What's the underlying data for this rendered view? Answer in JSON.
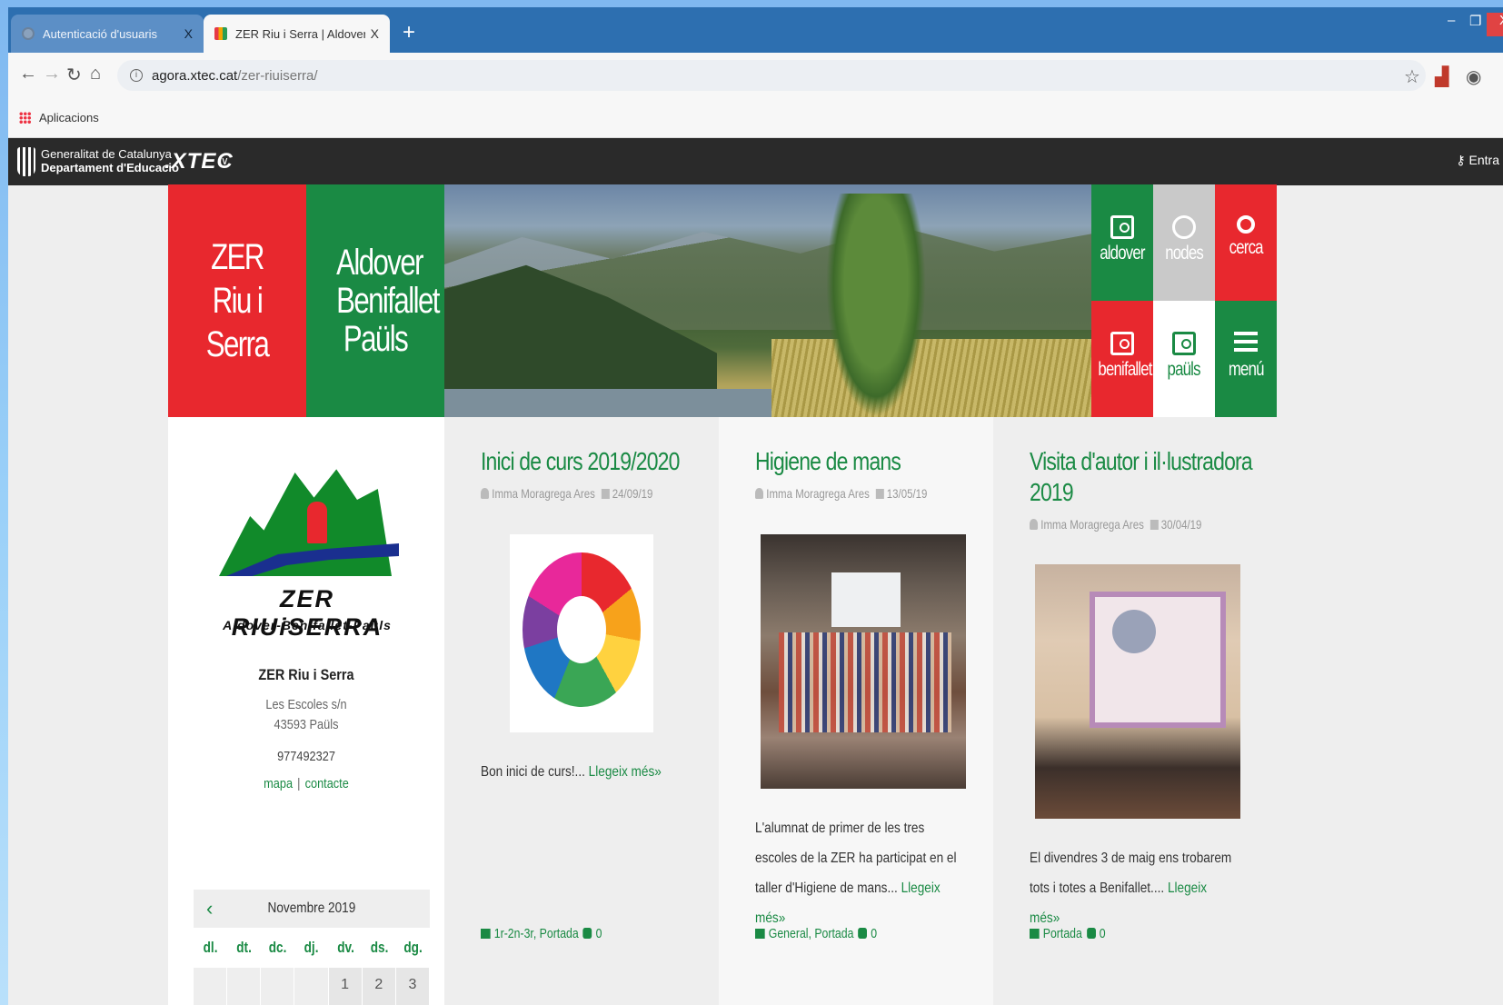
{
  "browser": {
    "tabs": [
      {
        "title": "Autenticació d'usuaris",
        "close": "X"
      },
      {
        "title": "ZER Riu i Serra | Aldover Benifalle",
        "close": "X"
      }
    ],
    "new_tab": "+",
    "window_controls": {
      "min": "–",
      "max": "❐",
      "close": "X"
    },
    "address": {
      "host": "agora.xtec.cat",
      "path": "/zer-riuiserra/"
    },
    "bookmarks": [
      {
        "label": "Aplicacions"
      }
    ]
  },
  "xtec_bar": {
    "gen_line1": "Generalitat de Catalunya",
    "gen_line2": "Departament d'Educació",
    "brand": ".XTEC",
    "login": "Entra"
  },
  "header": {
    "school_short": "ZER Riu i Serra",
    "towns": "Aldover Benifallet Paüls",
    "tiles": [
      {
        "label": "aldover",
        "icon": "screen-icon",
        "color": "#1a8a44"
      },
      {
        "label": "nodes",
        "icon": "globe-icon",
        "color": "#c9c9c9"
      },
      {
        "label": "cerca",
        "icon": "search-icon",
        "color": "#e8282e"
      },
      {
        "label": "benifallet",
        "icon": "screen-icon",
        "color": "#e8282e"
      },
      {
        "label": "paüls",
        "icon": "screen-icon",
        "color": "#ffffff"
      },
      {
        "label": "menú",
        "icon": "menu-icon",
        "color": "#1a8a44"
      }
    ]
  },
  "sidebar": {
    "logo_name": "ZER RIUiSERRA",
    "logo_sub": "Aldover-Benifallet-Paüls",
    "school_name": "ZER Riu i Serra",
    "address_line1": "Les Escoles s/n",
    "address_line2": "43593 Paüls",
    "phone": "977492327",
    "link_map": "mapa",
    "link_sep": "|",
    "link_contact": "contacte",
    "calendar": {
      "prev": "‹",
      "month": "Novembre 2019",
      "weekdays": [
        "dl.",
        "dt.",
        "dc.",
        "dj.",
        "dv.",
        "ds.",
        "dg."
      ],
      "first_row": [
        "",
        "",
        "",
        "",
        "1",
        "2",
        "3"
      ]
    }
  },
  "posts": [
    {
      "title": "Inici de curs 2019/2020",
      "author": "Imma Moragrega Ares",
      "date": "24/09/19",
      "excerpt": "Bon inici de curs!...",
      "more": "Llegeix més»",
      "categories": "1r-2n-3r, Portada",
      "comments": "0"
    },
    {
      "title": "Higiene de mans",
      "author": "Imma Moragrega Ares",
      "date": "13/05/19",
      "excerpt": "L'alumnat de primer de les tres escoles de la ZER ha participat en el taller d'Higiene de mans...",
      "more": "Llegeix més»",
      "categories": "General, Portada",
      "comments": "0"
    },
    {
      "title_line1": "Visita d'autor i il·lustradora",
      "title_line2": "2019",
      "author": "Imma Moragrega Ares",
      "date": "30/04/19",
      "excerpt": "El divendres 3 de maig ens trobarem tots i totes a Benifallet....",
      "more": "Llegeix més»",
      "categories": "Portada",
      "comments": "0"
    }
  ],
  "colors": {
    "red": "#e8282e",
    "green": "#1a8a44",
    "dark_bar": "#2a2a2a",
    "tab_bar": "#2d6fb0"
  }
}
